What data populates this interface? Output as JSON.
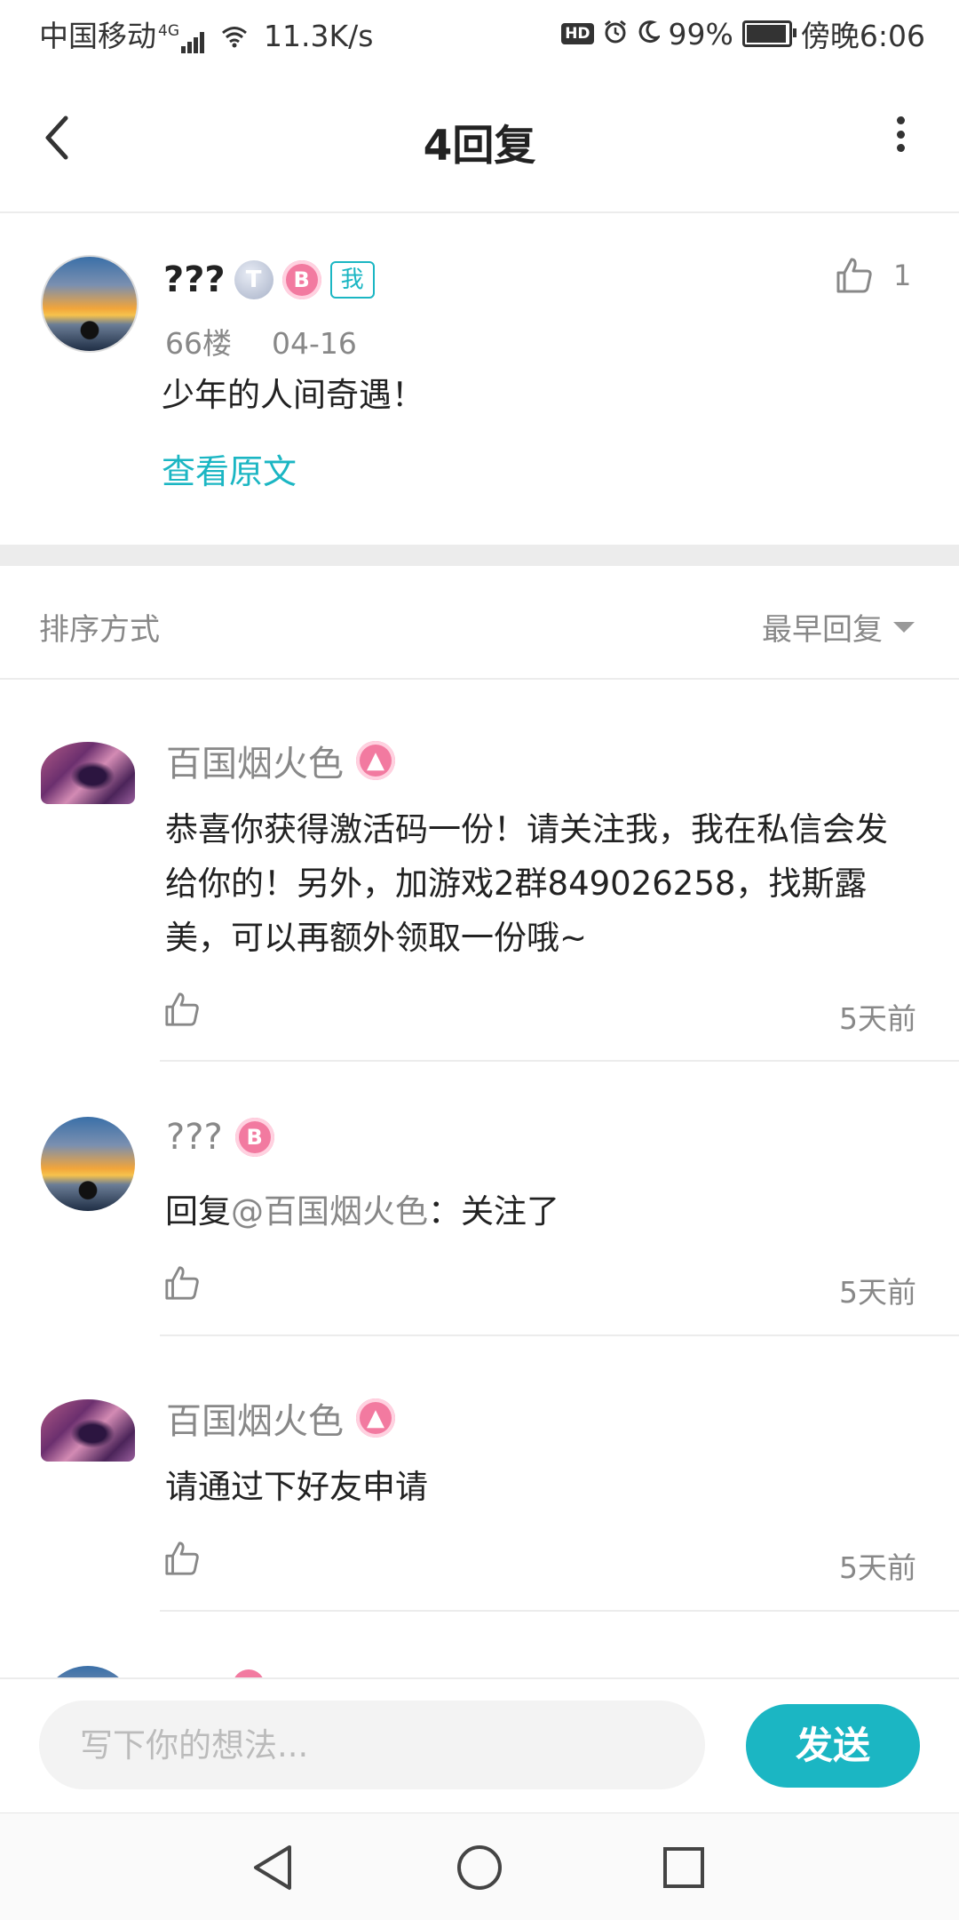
{
  "status_bar": {
    "carrier": "中国移动",
    "network": "4G",
    "speed": "11.3K/s",
    "hd": "HD",
    "battery": "99%",
    "time": "傍晚6:06",
    "icons": [
      "signal-icon",
      "wifi-icon",
      "alarm-icon",
      "moon-icon",
      "battery-icon"
    ]
  },
  "header": {
    "title": "4回复",
    "icons": [
      "back-arrow-icon",
      "more-vertical-icon"
    ]
  },
  "post": {
    "username": "???",
    "me_tag": "我",
    "badge_t": "T",
    "badge_p": "B",
    "floor": "66楼",
    "date": "04-16",
    "content": "少年的人间奇遇！",
    "likes": "1",
    "view_original": "查看原文"
  },
  "sort": {
    "label": "排序方式",
    "value": "最早回复"
  },
  "replies": [
    {
      "username": "百国烟火色",
      "badge": "fire",
      "content": "恭喜你获得激活码一份！请关注我，我在私信会发给你的！另外，加游戏2群849026258，找斯露美，可以再额外领取一份哦~",
      "time": "5天前"
    },
    {
      "username": "???",
      "badge": "B",
      "reply_prefix": "回复",
      "mention": "@百国烟火色",
      "content": "：关注了",
      "time": "5天前"
    },
    {
      "username": "百国烟火色",
      "badge": "fire",
      "content": "请通过下好友申请",
      "time": "5天前"
    }
  ],
  "input_bar": {
    "placeholder": "写下你的想法...",
    "send_label": "发送"
  },
  "colors": {
    "accent": "#1bb6c3",
    "badge_pink": "#f27aa0",
    "text_grey": "#888888"
  }
}
